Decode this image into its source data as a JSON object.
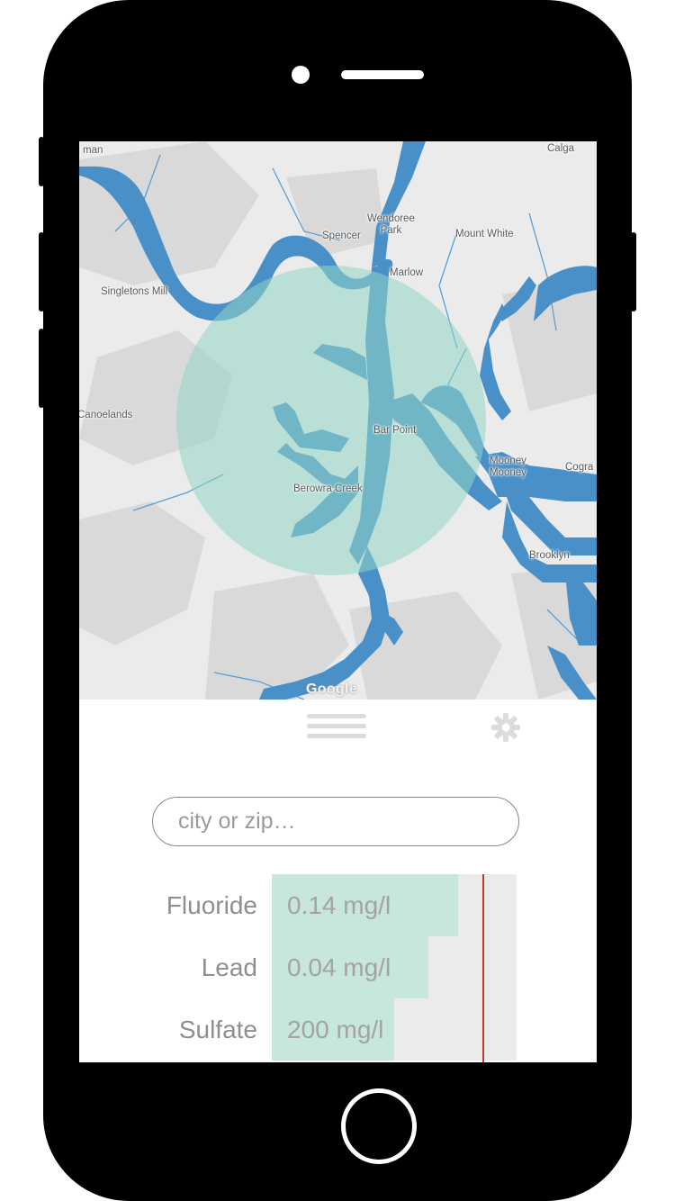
{
  "map": {
    "labels": {
      "man": "man",
      "calga": "Calga",
      "wendoree_park": "Wendoree\nPark",
      "spencer": "Spencer",
      "mount_white": "Mount White",
      "marlow": "Marlow",
      "singletons_mill": "Singletons Mill",
      "canoelands": "Canoelands",
      "bar_point": "Bar Point",
      "mooney_mooney": "Mooney\nMooney",
      "cogra": "Cogra",
      "brooklyn": "Brooklyn",
      "berowra_creek": "Berowra Creek"
    },
    "attribution": "Google",
    "colors": {
      "land": "#ebebeb",
      "water": "#4a90c8",
      "radius_circle": "#8fd6c4"
    }
  },
  "toolbar": {
    "menu_icon": "hamburger-menu-icon",
    "settings_icon": "gear-icon"
  },
  "search": {
    "placeholder": "city or zip…",
    "value": ""
  },
  "metrics": [
    {
      "name": "Fluoride",
      "value": "0.14 mg/l",
      "fill_fraction": 0.76
    },
    {
      "name": "Lead",
      "value": "0.04 mg/l",
      "fill_fraction": 0.64
    },
    {
      "name": "Sulfate",
      "value": "200 mg/l",
      "fill_fraction": 0.5
    }
  ],
  "limit_marker": {
    "fraction": 0.86,
    "color": "#c0392b"
  },
  "colors": {
    "bar_fill": "#c7e6de",
    "bar_track": "#ebebeb"
  }
}
